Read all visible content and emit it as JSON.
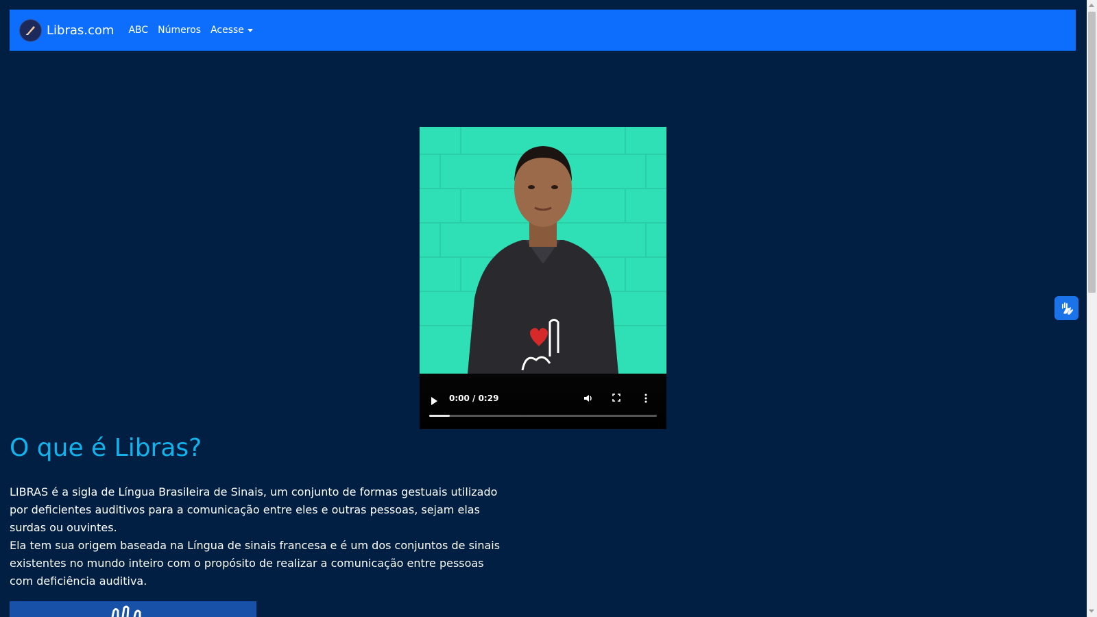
{
  "navbar": {
    "brand": "Libras.com",
    "links": [
      "ABC",
      "Números"
    ],
    "dropdown": "Acesse"
  },
  "video": {
    "time": "0:00 / 0:29",
    "progress": 0.09,
    "icons": [
      "play-icon",
      "volume-icon",
      "fullscreen-icon",
      "more-icon"
    ]
  },
  "content": {
    "heading": "O que é Libras?",
    "paragraph1": "LIBRAS é a sigla de Língua Brasileira de Sinais, um conjunto de formas gestuais utilizado por deficientes auditivos para a comunicação entre eles e outras pessoas, sejam elas surdas ou ouvintes.",
    "paragraph2": "Ela tem sua origem baseada na Língua de sinais francesa e é um dos conjuntos de sinais existentes no mundo inteiro com o propósito de realizar a comunicação entre pessoas com deficiência auditiva."
  },
  "colors": {
    "background": "#001f42",
    "navbar": "#0d6efd",
    "heading": "#12b3ec"
  }
}
